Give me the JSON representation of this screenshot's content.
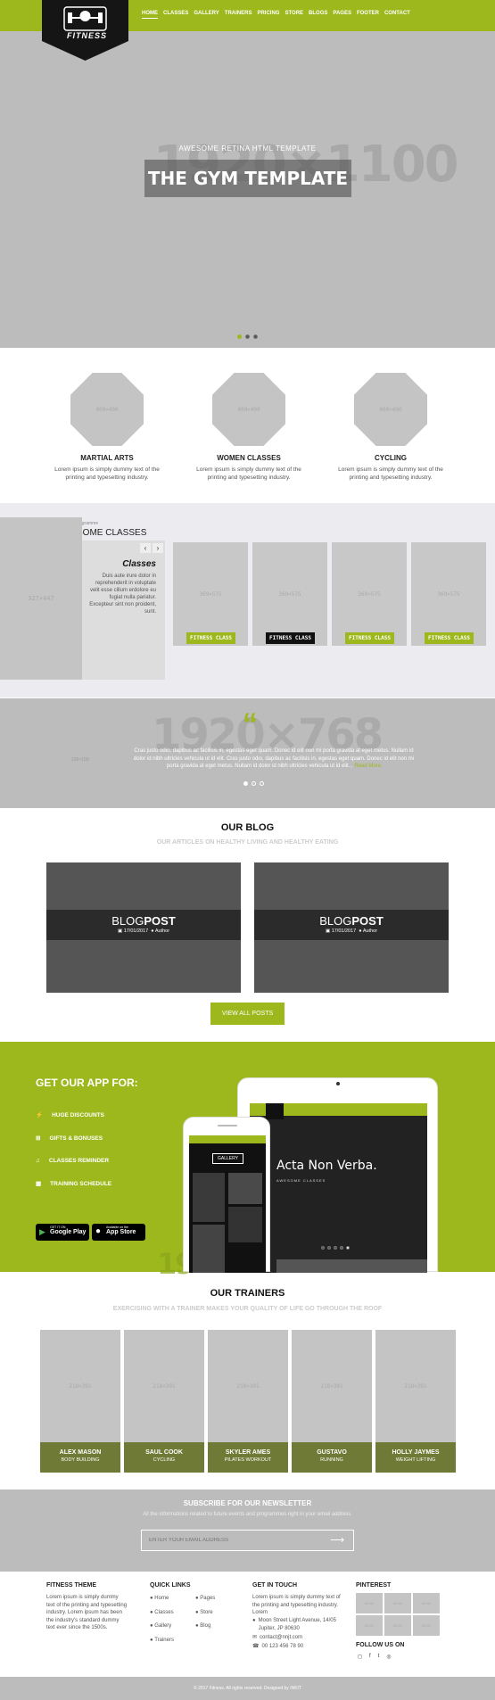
{
  "nav": {
    "items": [
      "HOME",
      "CLASSES",
      "GALLERY",
      "TRAINERS",
      "PRICING",
      "STORE",
      "BLOGS",
      "PAGES",
      "FOOTER",
      "CONTACT"
    ],
    "active": "HOME"
  },
  "logo": {
    "text": "FITNESS"
  },
  "hero": {
    "placeholder": "1920×1100",
    "subtitle": "AWESOME RETINA HTML TEMPLATE",
    "title": "THE GYM TEMPLATE"
  },
  "features": [
    {
      "img": "400×400",
      "title": "MARTIAL ARTS",
      "desc": "Lorem ipsum is simply dummy text of the printing and typesetting industry."
    },
    {
      "img": "400×400",
      "title": "WOMEN CLASSES",
      "desc": "Lorem ipsum is simply dummy text of the printing and typesetting industry."
    },
    {
      "img": "400×400",
      "title": "CYCLING",
      "desc": "Lorem ipsum is simply dummy text of the printing and typesetting industry."
    }
  ],
  "classes": {
    "side_img": "327×447",
    "eyebrow": "Programme",
    "heading": "SOME CLASSES",
    "panel_title": "Classes",
    "panel_text": "Duis aute irure dolor in reprehenderit in voluptate velit esse cillum erdolore eu fugiat nulla pariatur. Excepteur sint non proident, sunt.",
    "cards": [
      {
        "img": "369×575",
        "tag": "FITNESS CLASS",
        "tag_color": "#9cb81c"
      },
      {
        "img": "369×575",
        "tag": "FITNESS CLASS",
        "tag_color": "#111111"
      },
      {
        "img": "369×575",
        "tag": "FITNESS CLASS",
        "tag_color": "#9cb81c"
      },
      {
        "img": "369×575",
        "tag": "FITNESS CLASS",
        "tag_color": "#9cb81c"
      }
    ]
  },
  "testimonial": {
    "bg": "1920×768",
    "avatar": "100×100",
    "text": "Cras justo odio, dapibus ac facilisis in, egestas eget quam. Donec id elit non mi porta gravida at eget metus. Nullam id dolor id nibh ultricies vehicula ut id elit. Cras justo odio, dapibus ac facilisis in, egestas eget quam. Donec id elit non mi porta gravida at eget metus. Nullam id dolor id nibh ultricies vehicula ut id elit...",
    "more": "Read More"
  },
  "blog": {
    "title": "OUR BLOG",
    "subtitle": "OUR ARTICLES ON HEALTHY LIVING AND HEALTHY EATING",
    "posts": [
      {
        "word1": "BLOG",
        "word2": "POST",
        "date": "17/01/2017",
        "author": "Author"
      },
      {
        "word1": "BLOG",
        "word2": "POST",
        "date": "17/01/2017",
        "author": "Author"
      }
    ],
    "button": "VIEW ALL POSTS"
  },
  "app": {
    "heading": "GET OUR APP FOR:",
    "items": [
      "HUGE DISCOUNTS",
      "GIFTS & BONUSES",
      "CLASSES REMINDER",
      "TRAINING SCHEDULE"
    ],
    "google": {
      "small": "GET IT ON",
      "big": "Google Play"
    },
    "apple": {
      "small": "Available on the",
      "big": "App Store"
    },
    "tablet_title": "Acta Non Verba.",
    "tablet_sub": "AWESOME CLASSES",
    "phone_label": "GALLERY",
    "bg_num": "19"
  },
  "trainers": {
    "title": "OUR TRAINERS",
    "subtitle": "EXERCISING WITH A TRAINER MAKES YOUR QUALITY OF LIFE GO THROUGH THE ROOF",
    "people": [
      {
        "img": "218×391",
        "name": "ALEX MASON",
        "role": "BODY BUILDING"
      },
      {
        "img": "218×391",
        "name": "SAUL COOK",
        "role": "CYCLING"
      },
      {
        "img": "218×391",
        "name": "SKYLER AMES",
        "role": "PILATES WORKOUT"
      },
      {
        "img": "218×391",
        "name": "GUSTAVO",
        "role": "RUNNING"
      },
      {
        "img": "218×391",
        "name": "HOLLY JAYMES",
        "role": "WEIGHT LIFTING"
      }
    ]
  },
  "newsletter": {
    "title": "SUBSCRIBE FOR OUR NEWSLETTER",
    "text": "All the informations related to future events and programmes right in your email address.",
    "placeholder": "ENTER YOUR EMAIL ADDRESS"
  },
  "footer": {
    "theme": {
      "title": "FITNESS THEME",
      "text": "Lorem ipsum is simply dummy text of the printing and typesetting industry. Lorem ipsum has been the industry's standard dummy text ever since the 1500s."
    },
    "links": {
      "title": "QUICK LINKS",
      "col1": [
        "Home",
        "Classes",
        "Gallery",
        "Trainers"
      ],
      "col2": [
        "Pages",
        "Store",
        "Blog"
      ]
    },
    "contact": {
      "title": "GET IN TOUCH",
      "text": "Lorem ipsum is simply dummy text of the printing and typesetting industry. Lorem",
      "address": "Moon Street Light Avenue, 14/05 Jupiter, JP 80630",
      "email": "contact@nnjt.com",
      "phone": "00 123 456 78 90"
    },
    "pinterest": {
      "title": "PINTEREST",
      "tiles": [
        "80×80",
        "80×80",
        "80×80",
        "80×80",
        "80×80",
        "80×80"
      ]
    },
    "follow": "FOLLOW US ON",
    "copyright": "© 2017 Fitness. All rights reserved. Designed by INKIT"
  }
}
